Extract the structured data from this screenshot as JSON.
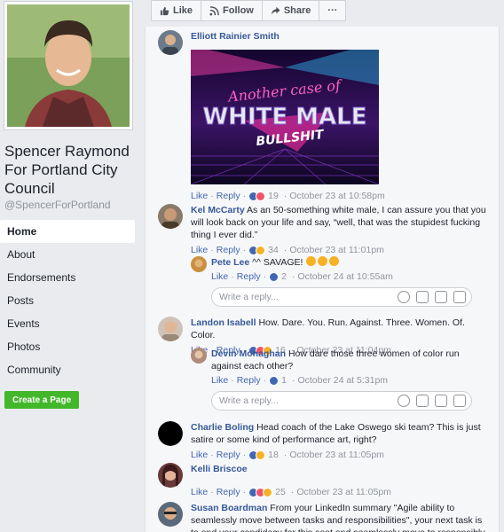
{
  "page": {
    "name": "Spencer Raymond For Portland City Council",
    "handle": "@SpencerForPortland"
  },
  "nav": {
    "items": [
      "Home",
      "About",
      "Endorsements",
      "Posts",
      "Events",
      "Photos",
      "Community"
    ],
    "create_page": "Create a Page"
  },
  "actions": {
    "like": "Like",
    "follow": "Follow",
    "share": "Share",
    "more": "···"
  },
  "comments": [
    {
      "author": "Elliott Rainier Smith",
      "text": "",
      "gif_text_1": "Another case of",
      "gif_text_2": "WHITE MALE",
      "gif_text_3": "BULLSHIT",
      "like": "Like",
      "reply": "Reply",
      "count": "19",
      "time": "October 23 at 10:58pm"
    },
    {
      "author": "Kel McCarty",
      "text": "As an 50-something white male, I can assure you that you will look back on your life and say, “well, that was the stupidest fucking thing I ever did.”",
      "like": "Like",
      "reply": "Reply",
      "count": "34",
      "time": "October 23 at 11:01pm"
    },
    {
      "author": "Pete Lee",
      "text": "^^ SAVAGE!",
      "like": "Like",
      "reply": "Reply",
      "count": "2",
      "time": "October 24 at 10:55am"
    },
    {
      "author": "Landon Isabell",
      "text": "How. Dare. You. Run. Against. Three. Women. Of. Color.",
      "like": "Like",
      "reply": "Reply",
      "count": "16",
      "time": "October 23 at 11:04pm"
    },
    {
      "author": "Devin Monaghan",
      "text": "How dare those three women of color run against each other?",
      "like": "Like",
      "reply": "Reply",
      "count": "1",
      "time": "October 24 at 5:31pm"
    },
    {
      "author": "Charlie Boling",
      "text": "Head coach of the Lake Oswego ski team? This is just satire or some kind of performance art, right?",
      "like": "Like",
      "reply": "Reply",
      "count": "18",
      "time": "October 23 at 11:05pm"
    },
    {
      "author": "Kelli Briscoe",
      "text": "",
      "like": "Like",
      "reply": "Reply",
      "count": "25",
      "time": "October 23 at 11:05pm"
    },
    {
      "author": "Susan Boardman",
      "text": "From your LinkedIn summary \"Agile ability to seamlessly move between tasks and responsibilities\", your next task is to end your candidacy for this seat and seamlessly move to responsibly"
    }
  ],
  "reply_placeholder": "Write a reply...",
  "colors": {
    "link": "#365899",
    "create_button": "#42b72a",
    "like": "#4267b2"
  }
}
